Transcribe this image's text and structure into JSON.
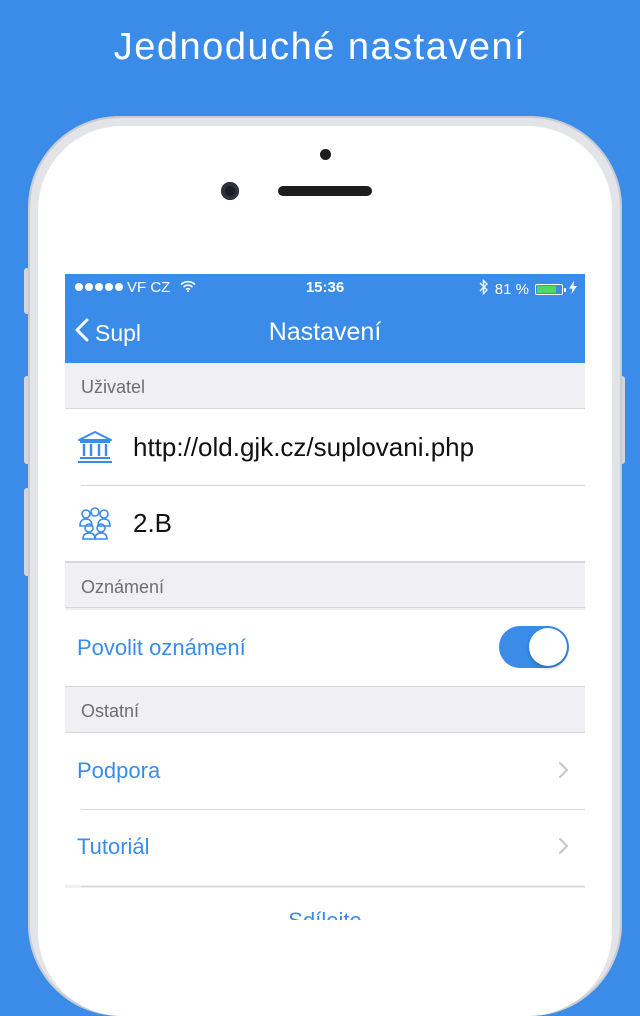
{
  "headline": "Jednoduché nastavení",
  "colors": {
    "accent": "#3a8ce8",
    "switch_on": "#3a8ce8",
    "battery": "#4cd964"
  },
  "status_bar": {
    "carrier": "VF CZ",
    "time": "15:36",
    "battery_percent": "81 %",
    "battery_level": 0.81
  },
  "nav": {
    "back_label": "Supl",
    "title": "Nastavení"
  },
  "sections": {
    "user": {
      "header": "Uživatel",
      "url_icon": "institution-building-icon",
      "url": "http://old.gjk.cz/suplovani.php",
      "class_icon": "group-people-icon",
      "class": "2.B"
    },
    "notifications": {
      "header": "Oznámení",
      "enable_label": "Povolit oznámení",
      "enabled": true
    },
    "other": {
      "header": "Ostatní",
      "support_label": "Podpora",
      "tutorial_label": "Tutoriál",
      "share_label": "Sdílejte"
    }
  }
}
